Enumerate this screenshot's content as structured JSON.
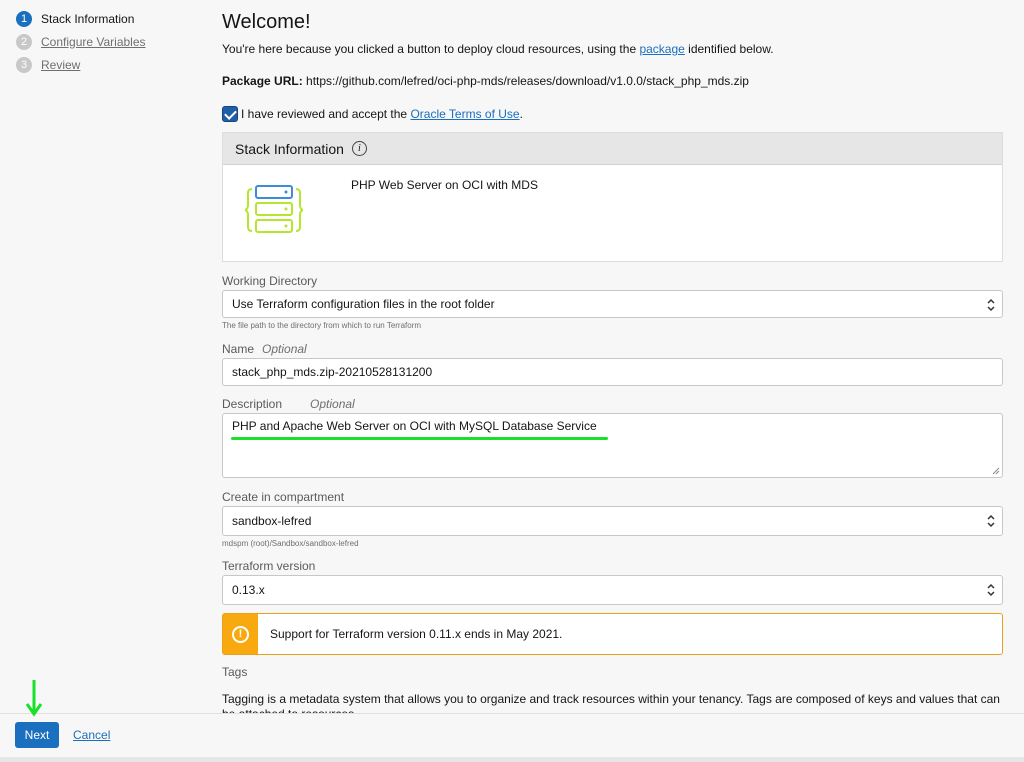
{
  "nav": {
    "steps": [
      {
        "num": "1",
        "label": "Stack Information"
      },
      {
        "num": "2",
        "label": "Configure Variables"
      },
      {
        "num": "3",
        "label": "Review"
      }
    ]
  },
  "main": {
    "title": "Welcome!",
    "intro_before": "You're here because you clicked a button to deploy cloud resources, using the ",
    "intro_link": "package",
    "intro_after": " identified below.",
    "package_label": "Package URL:",
    "package_url": " https://github.com/lefred/oci-php-mds/releases/download/v1.0.0/stack_php_mds.zip",
    "terms_before": "I have reviewed and accept the ",
    "terms_link": "Oracle Terms of Use",
    "terms_after": "."
  },
  "stack_card": {
    "header": "Stack Information",
    "name": "PHP Web Server on OCI with MDS"
  },
  "form": {
    "working_dir": {
      "label": "Working Directory",
      "value": "Use Terraform configuration files in the root folder",
      "hint": "The file path to the directory from which to run Terraform"
    },
    "name": {
      "label": "Name",
      "optional": "Optional",
      "value": "stack_php_mds.zip-20210528131200"
    },
    "description": {
      "label": "Description",
      "optional": "Optional",
      "value": "PHP and Apache Web Server on OCI with MySQL Database Service"
    },
    "compartment": {
      "label": "Create in compartment",
      "value": "sandbox-lefred",
      "hint": "mdspm (root)/Sandbox/sandbox-lefred"
    },
    "terraform": {
      "label": "Terraform version",
      "value": "0.13.x"
    },
    "warning": "Support for Terraform version 0.11.x ends in May 2021.",
    "tags": {
      "label": "Tags",
      "description": "Tagging is a metadata system that allows you to organize and track resources within your tenancy. Tags are composed of keys and values that can be attached to resources."
    }
  },
  "footer": {
    "next": "Next",
    "cancel": "Cancel"
  },
  "colors": {
    "accent": "#1a6fbf",
    "warning": "#f7a90f",
    "annotation": "#19e02a"
  }
}
